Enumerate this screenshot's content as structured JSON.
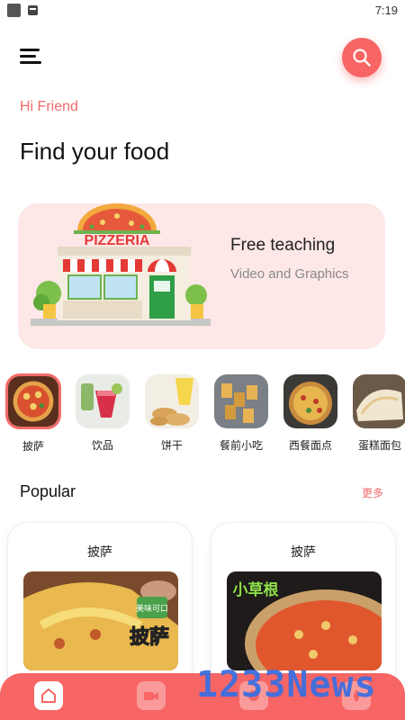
{
  "status_bar": {
    "time": "7:19"
  },
  "header": {
    "greeting": "Hi Friend",
    "title": "Find your food"
  },
  "banner": {
    "title": "Free teaching",
    "subtitle": "Video and Graphics",
    "sign_text": "PIZZERIA"
  },
  "categories": [
    {
      "label": "披萨",
      "selected": true
    },
    {
      "label": "饮品"
    },
    {
      "label": "饼干"
    },
    {
      "label": "餐前小吃"
    },
    {
      "label": "西餐面点"
    },
    {
      "label": "蛋糕面包"
    }
  ],
  "popular": {
    "title": "Popular",
    "more": "更多",
    "cards": [
      {
        "title": "披萨",
        "img_text": "披萨",
        "badge": "美味可口"
      },
      {
        "title": "披萨",
        "img_text": "小草根"
      }
    ]
  },
  "watermark": "1233News",
  "colors": {
    "accent": "#f76565",
    "banner_bg": "#fde7e7",
    "greeting": "#f06a6a"
  },
  "icons": {
    "menu": "hamburger-menu-icon",
    "search": "search-icon",
    "nav": [
      "home-icon",
      "video-icon",
      "chat-icon",
      "drop-icon"
    ]
  }
}
